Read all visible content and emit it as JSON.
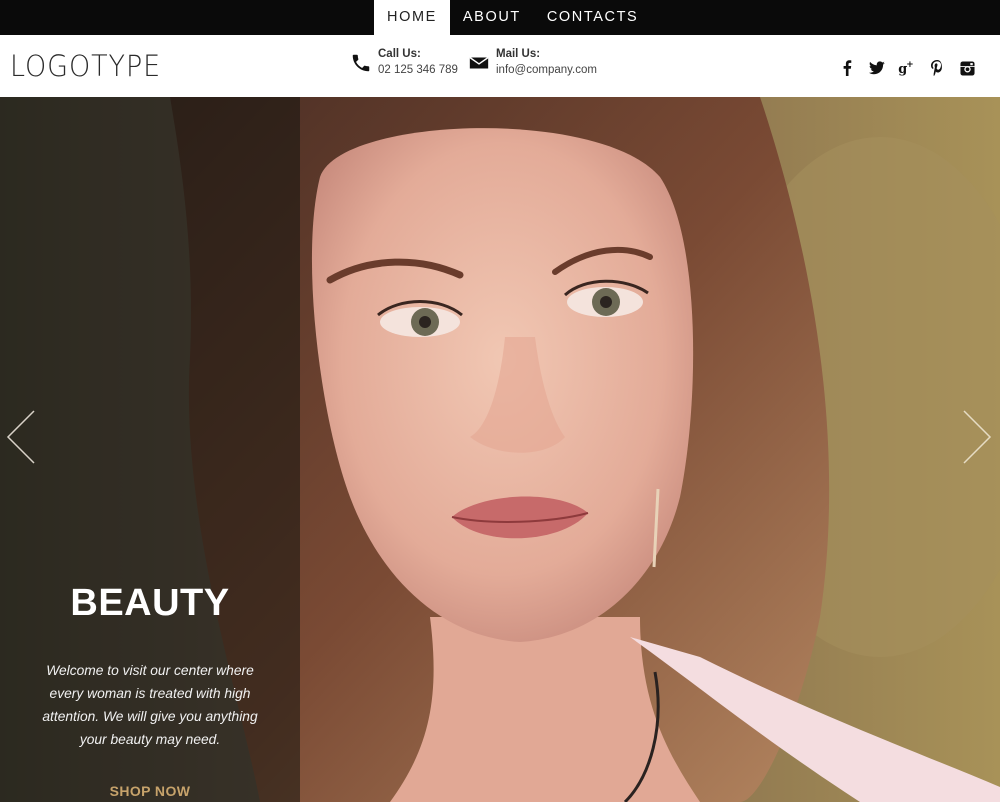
{
  "nav": {
    "items": [
      {
        "label": "HOME",
        "active": true
      },
      {
        "label": "ABOUT",
        "active": false
      },
      {
        "label": "CONTACTS",
        "active": false
      }
    ]
  },
  "header": {
    "logo": "LOGOTYPE",
    "call": {
      "label": "Call Us:",
      "value": "02 125 346 789",
      "icon": "phone-icon"
    },
    "mail": {
      "label": "Mail Us:",
      "value": "info@company.com",
      "icon": "envelope-icon"
    },
    "social": [
      "facebook-icon",
      "twitter-icon",
      "google-plus-icon",
      "pinterest-icon",
      "instagram-icon"
    ]
  },
  "hero": {
    "title": "BEAUTY",
    "description": "Welcome to visit our center where every woman is treated with high attention. We will give you anything your beauty may need.",
    "cta": "SHOP NOW",
    "accent_color": "#c7a36b"
  }
}
